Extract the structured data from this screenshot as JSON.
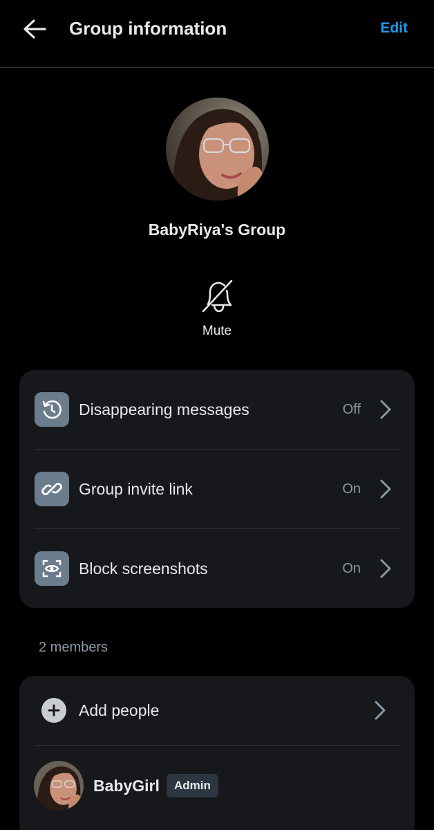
{
  "header": {
    "title": "Group information",
    "edit_label": "Edit"
  },
  "group": {
    "name": "BabyRiya's Group"
  },
  "mute": {
    "label": "Mute"
  },
  "settings": [
    {
      "label": "Disappearing messages",
      "value": "Off",
      "icon": "timer-history-icon"
    },
    {
      "label": "Group invite link",
      "value": "On",
      "icon": "link-icon"
    },
    {
      "label": "Block screenshots",
      "value": "On",
      "icon": "screenshot-eye-icon"
    }
  ],
  "members": {
    "count_label": "2 members",
    "add_label": "Add people",
    "list": [
      {
        "name": "BabyGirl",
        "badge": "Admin"
      }
    ]
  },
  "colors": {
    "background": "#000000",
    "card": "#16181c",
    "accent": "#1d9bf0",
    "icon_box": "#6b7c8c",
    "secondary_text": "#8b98a5"
  }
}
